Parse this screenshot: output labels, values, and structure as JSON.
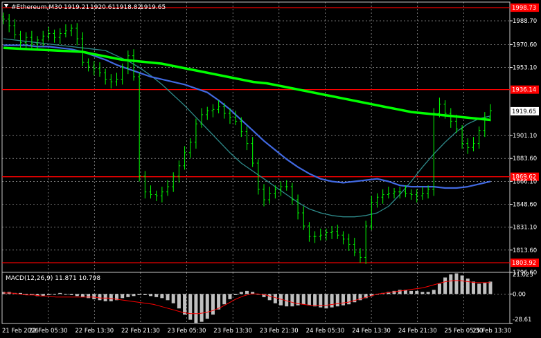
{
  "header": {
    "symbol_label": "#Ethereum,M30",
    "ohlc": [
      "1919.21",
      "1920.61",
      "1918.82",
      "1919.65"
    ]
  },
  "macd_label": "MACD(12,26,9) 11.871 10.798",
  "colors": {
    "background": "#000000",
    "grid": "#c8c8c8",
    "candles": "#00ff00",
    "level_lines": "#ff0000",
    "ma_fast": "#2e8b8b",
    "ma_mid": "#4169e1",
    "ma_slow": "#00ff00",
    "macd_hist": "#c0c0c0",
    "macd_signal": "#ff0000",
    "current_price_box": "#ffffff"
  },
  "chart_data": {
    "type": "line",
    "subtype": "candlestick",
    "title": "#Ethereum,M30",
    "ylim": [
      1796.6,
      2003.0
    ],
    "y_ticks": [
      "1988.70",
      "1970.60",
      "1953.10",
      "1936.14",
      "1919.65",
      "1901.10",
      "1883.60",
      "1869.62",
      "1866.10",
      "1848.60",
      "1831.10",
      "1813.60",
      "1803.92",
      "1796.60"
    ],
    "price_tick_values": [
      1988.7,
      1970.6,
      1953.1,
      1901.1,
      1883.6,
      1866.1,
      1848.6,
      1831.1,
      1813.6,
      1796.6
    ],
    "x_ticks": [
      "21 Feb 2026",
      "22 Feb 05:30",
      "22 Feb 13:30",
      "22 Feb 21:30",
      "23 Feb 05:30",
      "23 Feb 13:30",
      "23 Feb 21:30",
      "24 Feb 05:30",
      "24 Feb 13:30",
      "24 Feb 21:30",
      "25 Feb 05:30",
      "25 Feb 13:30"
    ],
    "current_price": 1919.65,
    "horizontal_levels": [
      1998.73,
      1936.14,
      1869.62,
      1803.92
    ],
    "close_series": [
      1990,
      1985,
      1978,
      1972,
      1976,
      1971,
      1974,
      1977,
      1979,
      1976,
      1979,
      1981,
      1983,
      1975,
      1957,
      1954,
      1952,
      1949,
      1944,
      1942,
      1944,
      1953,
      1962,
      1946,
      1870,
      1858,
      1856,
      1855,
      1858,
      1862,
      1870,
      1878,
      1888,
      1896,
      1910,
      1917,
      1920,
      1921,
      1923,
      1918,
      1915,
      1912,
      1904,
      1895,
      1880,
      1860,
      1852,
      1857,
      1860,
      1862,
      1862,
      1852,
      1842,
      1832,
      1824,
      1824,
      1825,
      1827,
      1828,
      1825,
      1822,
      1818,
      1812,
      1808,
      1832,
      1850,
      1854,
      1856,
      1857,
      1858,
      1858,
      1857,
      1856,
      1855,
      1857,
      1860,
      1918,
      1925,
      1918,
      1912,
      1906,
      1895,
      1892,
      1895,
      1905,
      1915,
      1920
    ],
    "series": [
      {
        "name": "MA fast",
        "values": [
          1975,
          1974,
          1973,
          1972,
          1971,
          1970,
          1969,
          1968,
          1967,
          1966,
          1962,
          1958,
          1953,
          1947,
          1940,
          1932,
          1924,
          1915,
          1906,
          1897,
          1888,
          1880,
          1874,
          1868,
          1862,
          1856,
          1850,
          1845,
          1842,
          1840,
          1839,
          1839,
          1840,
          1842,
          1847,
          1856,
          1866,
          1877,
          1887,
          1896,
          1904,
          1910,
          1914,
          1916
        ]
      },
      {
        "name": "MA mid",
        "values": [
          1970,
          1970,
          1970,
          1969,
          1969,
          1968,
          1967,
          1965,
          1962,
          1959,
          1955,
          1952,
          1949,
          1946,
          1944,
          1942,
          1940,
          1937,
          1934,
          1928,
          1921,
          1913,
          1905,
          1897,
          1890,
          1883,
          1877,
          1872,
          1868,
          1866,
          1865,
          1866,
          1867,
          1868,
          1866,
          1863,
          1862,
          1862,
          1862,
          1861,
          1861,
          1862,
          1864,
          1866
        ]
      },
      {
        "name": "MA slow",
        "values": [
          1968,
          1967.5,
          1967,
          1966.5,
          1966,
          1965.5,
          1965,
          1963,
          1961,
          1959,
          1958,
          1957,
          1956,
          1954,
          1952,
          1950,
          1948,
          1946,
          1944,
          1942,
          1941,
          1939,
          1937,
          1935,
          1933,
          1931,
          1929,
          1927,
          1925,
          1923,
          1921,
          1919,
          1918,
          1917,
          1916,
          1915,
          1914,
          1913
        ]
      }
    ],
    "macd": {
      "ylim": [
        -28.61,
        21.023
      ],
      "y_ticks": [
        "21.023",
        "0.00",
        "-28.61"
      ],
      "histogram": [
        2,
        2,
        1,
        1,
        0,
        -1,
        -2,
        -2,
        -1,
        0,
        1,
        0,
        -1,
        -2,
        -3,
        -4,
        -5,
        -6,
        -7,
        -7,
        -6,
        -4,
        -3,
        -2,
        -1,
        -1,
        -2,
        -3,
        -4,
        -6,
        -9,
        -14,
        -20,
        -25,
        -28,
        -27,
        -24,
        -20,
        -15,
        -10,
        -5,
        -1,
        2,
        3,
        2,
        0,
        -3,
        -6,
        -9,
        -11,
        -12,
        -12,
        -11,
        -10,
        -11,
        -12,
        -13,
        -14,
        -13,
        -12,
        -11,
        -10,
        -8,
        -6,
        -4,
        -2,
        0,
        1,
        2,
        3,
        4,
        4,
        3,
        3,
        2,
        2,
        4,
        10,
        16,
        19,
        20,
        18,
        15,
        12,
        10,
        11,
        12
      ],
      "signal": [
        1,
        1,
        0,
        -1,
        -1,
        -2,
        -2,
        -3,
        -3,
        -3,
        -3,
        -3,
        -3,
        -4,
        -4,
        -5,
        -6,
        -7,
        -8,
        -9,
        -10,
        -12,
        -14,
        -16,
        -18,
        -19,
        -19,
        -18,
        -16,
        -13,
        -9,
        -5,
        -2,
        0,
        0,
        -1,
        -3,
        -5,
        -7,
        -9,
        -10,
        -11,
        -11,
        -11,
        -10,
        -9,
        -8,
        -6,
        -4,
        -2,
        0,
        1,
        2,
        3,
        4,
        5,
        6,
        8,
        10,
        12,
        13,
        13,
        12,
        11,
        11,
        11
      ]
    }
  }
}
